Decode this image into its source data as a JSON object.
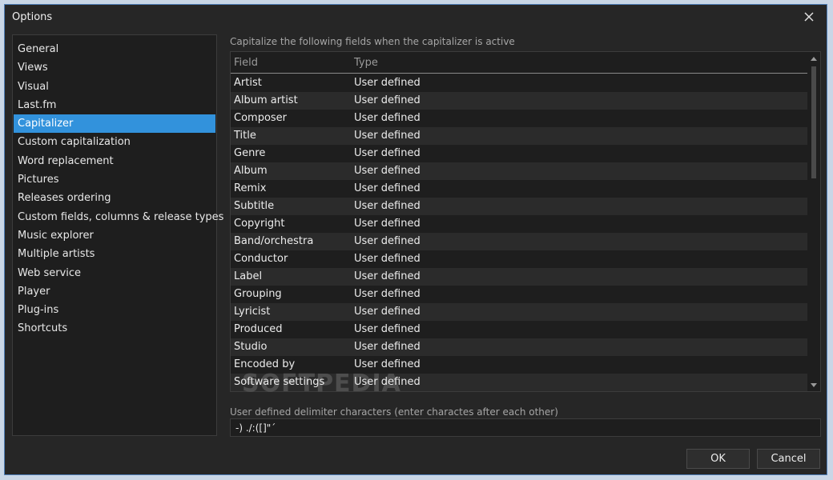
{
  "window": {
    "title": "Options"
  },
  "sidebar": {
    "items": [
      {
        "label": "General"
      },
      {
        "label": "Views"
      },
      {
        "label": "Visual"
      },
      {
        "label": "Last.fm"
      },
      {
        "label": "Capitalizer",
        "selected": true
      },
      {
        "label": "Custom capitalization"
      },
      {
        "label": "Word replacement"
      },
      {
        "label": "Pictures"
      },
      {
        "label": "Releases ordering"
      },
      {
        "label": "Custom fields, columns & release types"
      },
      {
        "label": "Music explorer"
      },
      {
        "label": "Multiple artists"
      },
      {
        "label": "Web service"
      },
      {
        "label": "Player"
      },
      {
        "label": "Plug-ins"
      },
      {
        "label": "Shortcuts"
      }
    ]
  },
  "main": {
    "fields_label": "Capitalize the following fields when the capitalizer is active",
    "columns": {
      "field": "Field",
      "type": "Type"
    },
    "rows": [
      {
        "field": "Artist",
        "type": "User defined"
      },
      {
        "field": "Album artist",
        "type": "User defined"
      },
      {
        "field": "Composer",
        "type": "User defined"
      },
      {
        "field": "Title",
        "type": "User defined"
      },
      {
        "field": "Genre",
        "type": "User defined"
      },
      {
        "field": "Album",
        "type": "User defined"
      },
      {
        "field": "Remix",
        "type": "User defined"
      },
      {
        "field": "Subtitle",
        "type": "User defined"
      },
      {
        "field": "Copyright",
        "type": "User defined"
      },
      {
        "field": "Band/orchestra",
        "type": "User defined"
      },
      {
        "field": "Conductor",
        "type": "User defined"
      },
      {
        "field": "Label",
        "type": "User defined"
      },
      {
        "field": "Grouping",
        "type": "User defined"
      },
      {
        "field": "Lyricist",
        "type": "User defined"
      },
      {
        "field": "Produced",
        "type": "User defined"
      },
      {
        "field": "Studio",
        "type": "User defined"
      },
      {
        "field": "Encoded by",
        "type": "User defined"
      },
      {
        "field": "Software settings",
        "type": "User defined"
      }
    ],
    "delimiter_label": "User defined delimiter characters (enter charactes after each other)",
    "delimiter_value": "-) ./:([]\"´"
  },
  "buttons": {
    "ok": "OK",
    "cancel": "Cancel"
  },
  "watermark": "SOFTPEDIA",
  "colors": {
    "background": "#262626",
    "panel": "#1e1e1e",
    "selection": "#3292dc",
    "border": "#3c3c3c"
  },
  "icons": {
    "close": "close-icon",
    "scroll_up": "scroll-up-icon",
    "scroll_down": "scroll-down-icon"
  }
}
